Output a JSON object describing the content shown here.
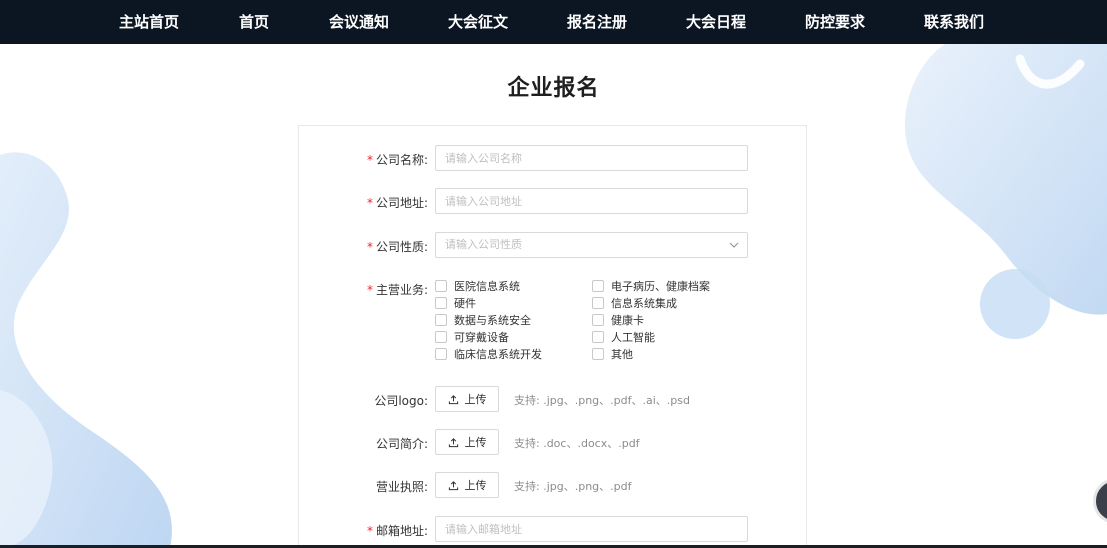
{
  "nav": {
    "items": [
      "主站首页",
      "首页",
      "会议通知",
      "大会征文",
      "报名注册",
      "大会日程",
      "防控要求",
      "联系我们"
    ]
  },
  "page_title": "企业报名",
  "required_mark": "*",
  "form": {
    "company_name": {
      "label": "公司名称:",
      "placeholder": "请输入公司名称"
    },
    "company_address": {
      "label": "公司地址:",
      "placeholder": "请输入公司地址"
    },
    "company_type": {
      "label": "公司性质:",
      "placeholder": "请输入公司性质"
    },
    "main_business": {
      "label": "主营业务:",
      "options": [
        "医院信息系统",
        "电子病历、健康档案",
        "硬件",
        "信息系统集成",
        "数据与系统安全",
        "健康卡",
        "可穿戴设备",
        "人工智能",
        "临床信息系统开发",
        "其他"
      ]
    },
    "logo": {
      "label": "公司logo:",
      "button": "上传",
      "hint": "支持: .jpg、.png、.pdf、.ai、.psd"
    },
    "intro": {
      "label": "公司简介:",
      "button": "上传",
      "hint": "支持: .doc、.docx、.pdf"
    },
    "license": {
      "label": "营业执照:",
      "button": "上传",
      "hint": "支持: .jpg、.png、.pdf"
    },
    "email": {
      "label": "邮箱地址:",
      "placeholder": "请输入邮箱地址"
    }
  },
  "colors": {
    "nav_bg": "#0b1622",
    "required": "#f5222d",
    "deco_blue": "#bcd6f2"
  },
  "icons": [
    "chevron-down-icon",
    "upload-icon"
  ]
}
